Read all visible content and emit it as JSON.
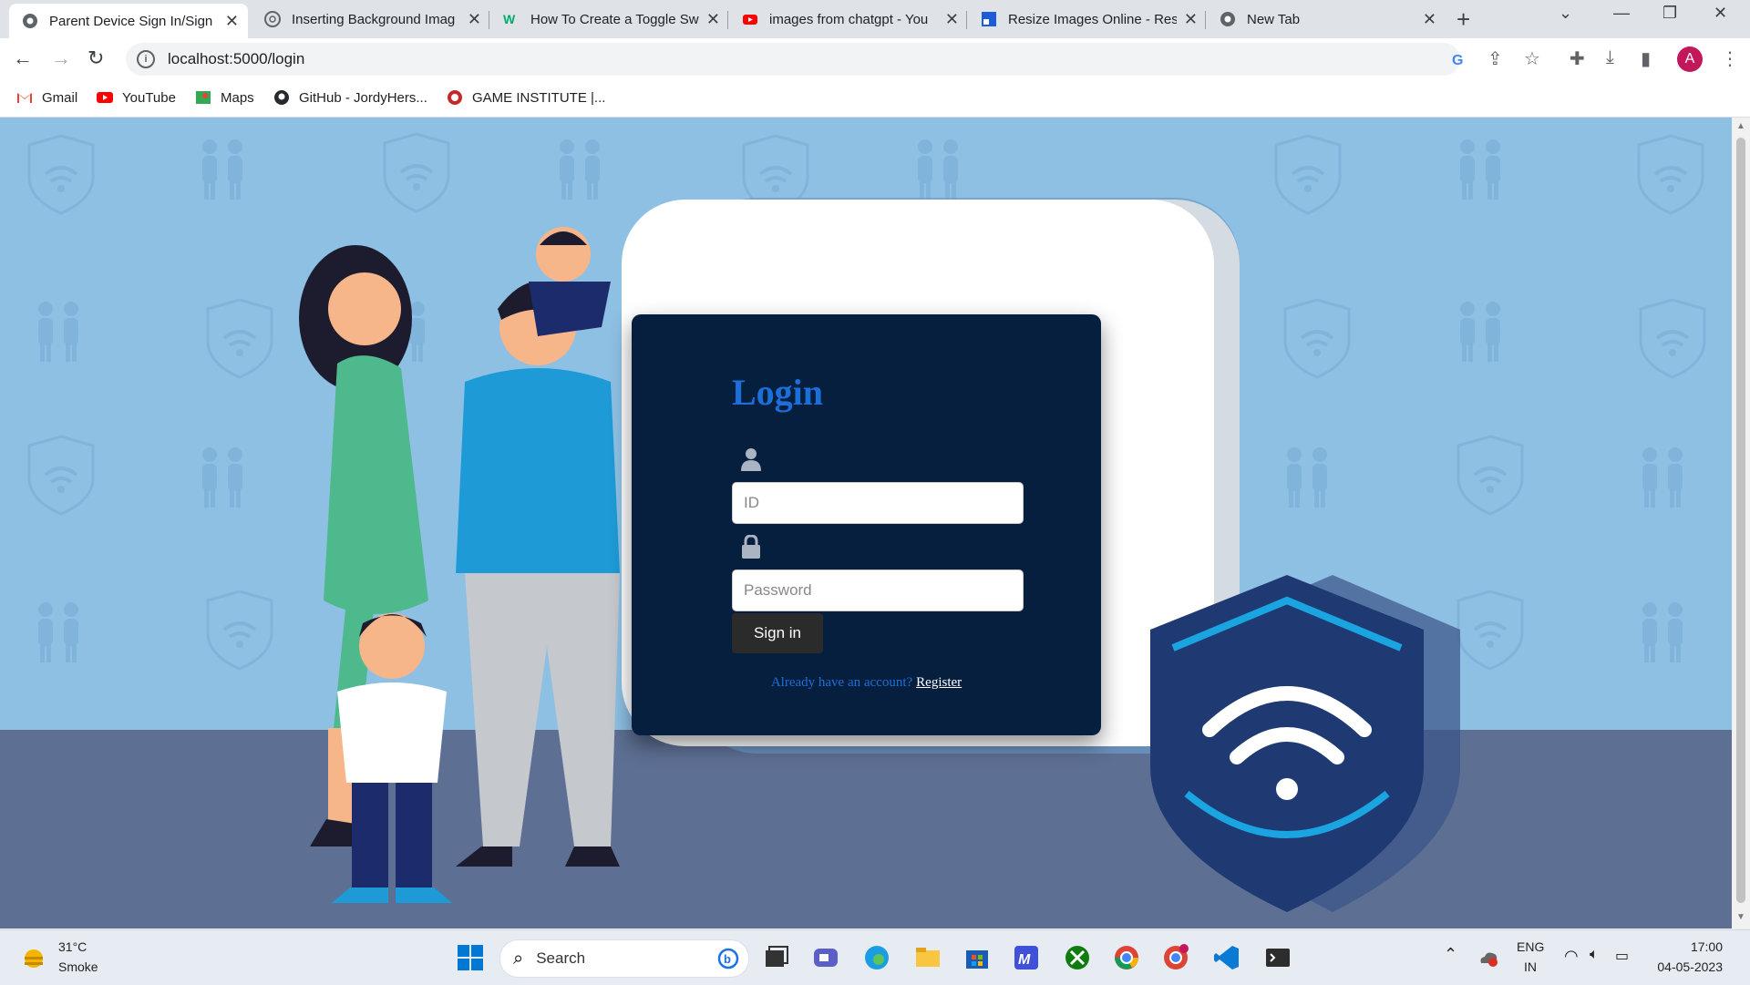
{
  "browser": {
    "tabs": [
      {
        "title": "Parent Device Sign In/Sign",
        "icon": "chrome-globe-icon",
        "active": true
      },
      {
        "title": "Inserting Background Imag",
        "icon": "chatgpt-icon"
      },
      {
        "title": "How To Create a Toggle Sw",
        "icon": "w3schools-icon"
      },
      {
        "title": "images from chatgpt - You",
        "icon": "youtube-icon"
      },
      {
        "title": "Resize Images Online - Res",
        "icon": "resize-app-icon"
      },
      {
        "title": "New Tab",
        "icon": "chrome-icon"
      }
    ],
    "url": "localhost:5000/login",
    "avatar_letter": "A",
    "bookmarks": [
      {
        "label": "Gmail",
        "icon": "gmail-icon"
      },
      {
        "label": "YouTube",
        "icon": "youtube-icon"
      },
      {
        "label": "Maps",
        "icon": "maps-icon"
      },
      {
        "label": "GitHub - JordyHers...",
        "icon": "github-icon"
      },
      {
        "label": "GAME INSTITUTE |...",
        "icon": "game-institute-icon"
      }
    ]
  },
  "login": {
    "title": "Login",
    "id_placeholder": "ID",
    "password_placeholder": "Password",
    "signin_label": "Sign in",
    "register_prompt": "Already have an account?",
    "register_link": "Register"
  },
  "taskbar": {
    "weather_temp": "31°C",
    "weather_desc": "Smoke",
    "search_label": "Search",
    "lang_top": "ENG",
    "lang_bottom": "IN",
    "time": "17:00",
    "date": "04-05-2023"
  },
  "colors": {
    "page_bg": "#8ec0e4",
    "card_bg": "#071f3f",
    "accent": "#1c6fd8",
    "shield": "#1f3a73"
  }
}
